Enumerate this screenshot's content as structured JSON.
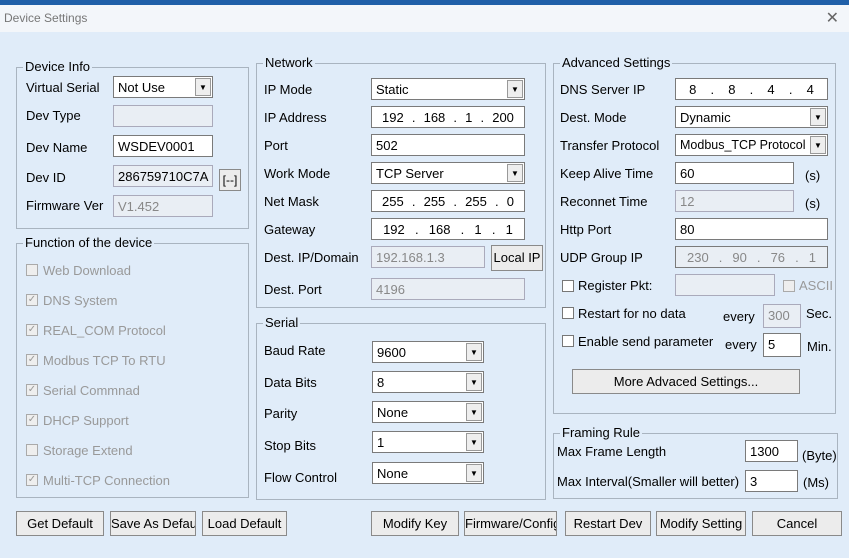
{
  "window": {
    "title": "Device Settings",
    "close": "✕"
  },
  "device_info": {
    "title": "Device Info",
    "virtual_serial_label": "Virtual Serial",
    "virtual_serial": "Not Use",
    "dev_type_label": "Dev Type",
    "dev_type": "",
    "dev_name_label": "Dev Name",
    "dev_name": "WSDEV0001",
    "dev_id_label": "Dev ID",
    "dev_id": "286759710C7A",
    "dev_id_button": "[--]",
    "firmware_label": "Firmware Ver",
    "firmware": "V1.452"
  },
  "functions": {
    "title": "Function of the device",
    "items": [
      {
        "label": "Web Download",
        "checked": false
      },
      {
        "label": "DNS System",
        "checked": true
      },
      {
        "label": "REAL_COM Protocol",
        "checked": true
      },
      {
        "label": "Modbus TCP To RTU",
        "checked": true
      },
      {
        "label": "Serial Commnad",
        "checked": true
      },
      {
        "label": "DHCP Support",
        "checked": true
      },
      {
        "label": "Storage Extend",
        "checked": false
      },
      {
        "label": "Multi-TCP Connection",
        "checked": true
      }
    ]
  },
  "network": {
    "title": "Network",
    "ip_mode_label": "IP Mode",
    "ip_mode": "Static",
    "ip_address_label": "IP Address",
    "ip_address": [
      "192",
      "168",
      "1",
      "200"
    ],
    "port_label": "Port",
    "port": "502",
    "work_mode_label": "Work Mode",
    "work_mode": "TCP Server",
    "net_mask_label": "Net Mask",
    "net_mask": [
      "255",
      "255",
      "255",
      "0"
    ],
    "gateway_label": "Gateway",
    "gateway": [
      "192",
      "168",
      "1",
      "1"
    ],
    "dest_ip_label": "Dest. IP/Domain",
    "dest_ip": "192.168.1.3",
    "local_ip_button": "Local IP",
    "dest_port_label": "Dest. Port",
    "dest_port": "4196"
  },
  "serial": {
    "title": "Serial",
    "baud_label": "Baud Rate",
    "baud": "9600",
    "data_bits_label": "Data Bits",
    "data_bits": "8",
    "parity_label": "Parity",
    "parity": "None",
    "stop_bits_label": "Stop Bits",
    "stop_bits": "1",
    "flow_label": "Flow Control",
    "flow": "None"
  },
  "advanced": {
    "title": "Advanced Settings",
    "dns_label": "DNS Server IP",
    "dns": [
      "8",
      "8",
      "4",
      "4"
    ],
    "dest_mode_label": "Dest. Mode",
    "dest_mode": "Dynamic",
    "transfer_label": "Transfer Protocol",
    "transfer": "Modbus_TCP Protocol",
    "keepalive_label": "Keep Alive Time",
    "keepalive": "60",
    "unit_s": "(s)",
    "reconnect_label": "Reconnet Time",
    "reconnect": "12",
    "http_label": "Http Port",
    "http": "80",
    "udp_label": "UDP Group IP",
    "udp": [
      "230",
      "90",
      "76",
      "1"
    ],
    "register_label": "Register Pkt:",
    "register": "",
    "ascii_label": "ASCII",
    "restart_label": "Restart for no data",
    "every": "every",
    "restart_value": "300",
    "sec": "Sec.",
    "enable_label": "Enable send parameter",
    "enable_value": "5",
    "min": "Min.",
    "more_button": "More Advaced Settings..."
  },
  "framing": {
    "title": "Framing Rule",
    "max_frame_label": "Max Frame Length",
    "max_frame": "1300",
    "byte_unit": "(Byte)",
    "max_interval_label": "Max Interval(Smaller will better)",
    "max_interval": "3",
    "ms_unit": "(Ms)"
  },
  "buttons": {
    "get_default": "Get Default",
    "save_as_default": "Save As Default",
    "load_default": "Load Default",
    "modify_key": "Modify Key",
    "firmware_config": "Firmware/Config",
    "restart_dev": "Restart Dev",
    "modify_setting": "Modify Setting",
    "cancel": "Cancel"
  }
}
